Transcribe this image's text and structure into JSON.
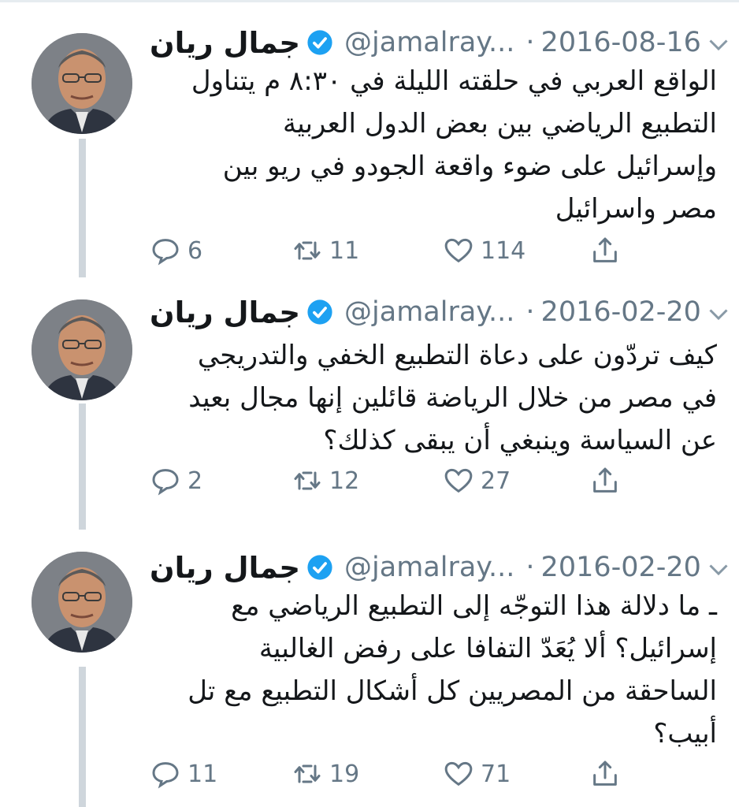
{
  "tweets": [
    {
      "name": "جمال ريان",
      "handle": "@jamalray...",
      "separator": "·",
      "date": "2016-08-16",
      "text": "الواقع العربي في حلقته الليلة  في ٨:٣٠ م يتناول\nالتطبيع الرياضي بين بعض الدول العربية\nوإسرائيل على ضوء  واقعة الجودو في ريو بين\nمصر واسرائيل",
      "replies": "6",
      "retweets": "11",
      "likes": "114"
    },
    {
      "name": "جمال ريان",
      "handle": "@jamalray...",
      "separator": "·",
      "date": "2016-02-20",
      "text": "كيف تردّون على دعاة التطبيع الخفي والتدريجي\nفي مصر من خلال الرياضة قائلين إنها مجال بعيد\nعن السياسة وينبغي أن يبقى كذلك؟",
      "replies": "2",
      "retweets": "12",
      "likes": "27"
    },
    {
      "name": "جمال ريان",
      "handle": "@jamalray...",
      "separator": "·",
      "date": "2016-02-20",
      "text": "ـ ما دلالة هذا التوجّه إلى التطبيع الرياضي مع\nإسرائيل؟ ألا يُعَدّ التفافا على رفض الغالبية\nالساحقة من المصريين كل أشكال التطبيع مع تل\nأبيب؟",
      "replies": "11",
      "retweets": "19",
      "likes": "71"
    }
  ],
  "icons": {
    "verified": "verified-badge-icon",
    "more": "chevron-down-icon",
    "reply": "reply-icon",
    "retweet": "retweet-icon",
    "like": "heart-icon",
    "share": "share-icon"
  },
  "colors": {
    "text": "#14171a",
    "secondary": "#657786",
    "verified": "#1da1f2",
    "thread_line": "#cfd6dc"
  }
}
